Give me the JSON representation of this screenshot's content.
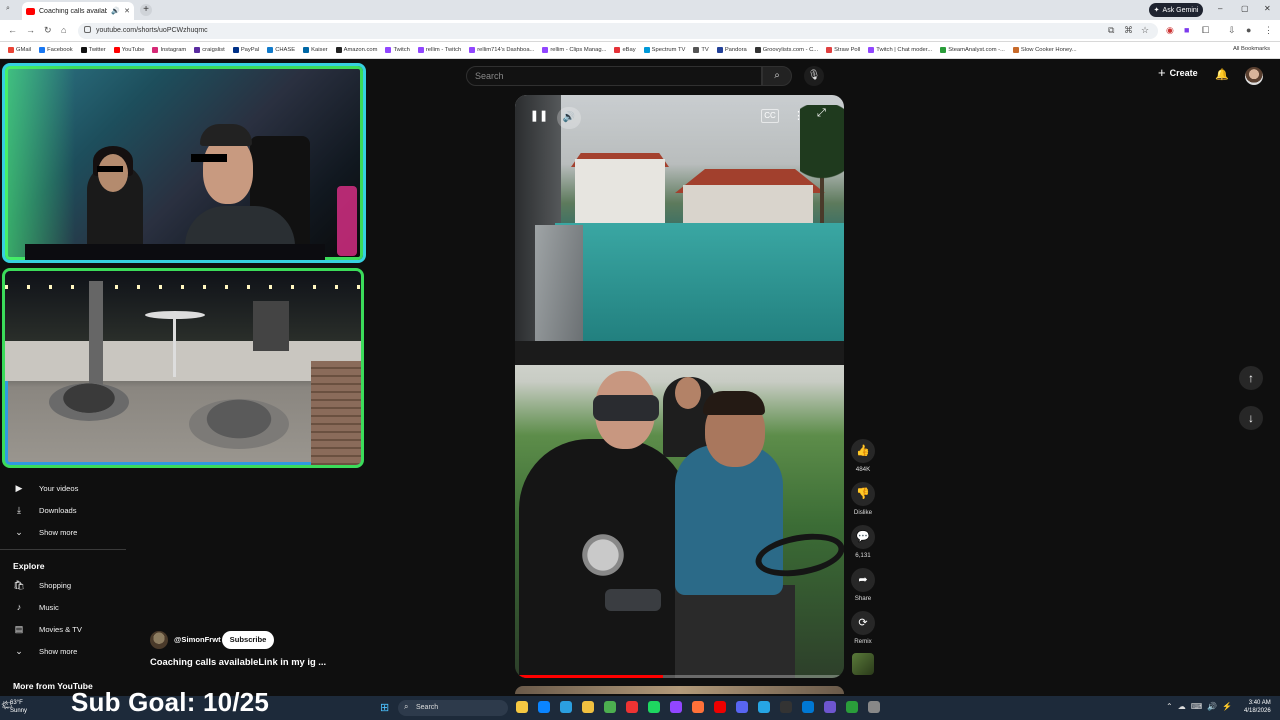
{
  "browser": {
    "tab_title": "Coaching calls availableLink",
    "new_tab": "+",
    "ask_gemini": "Ask Gemini",
    "url": "youtube.com/shorts/uoPCWzhuqmc",
    "window_controls": [
      "–",
      "▢",
      "✕"
    ],
    "bookmarks": [
      {
        "label": "GMail",
        "color": "#ea4335"
      },
      {
        "label": "Facebook",
        "color": "#1877f2"
      },
      {
        "label": "Twitter",
        "color": "#111111"
      },
      {
        "label": "YouTube",
        "color": "#ff0000"
      },
      {
        "label": "Instagram",
        "color": "#d62976"
      },
      {
        "label": "craigslist",
        "color": "#5a2ca0"
      },
      {
        "label": "PayPal",
        "color": "#003087"
      },
      {
        "label": "CHASE",
        "color": "#117aca"
      },
      {
        "label": "Kaiser",
        "color": "#0067a5"
      },
      {
        "label": "Amazon.com",
        "color": "#222222"
      },
      {
        "label": "Twitch",
        "color": "#9146ff"
      },
      {
        "label": "rellim - Twitch",
        "color": "#9146ff"
      },
      {
        "label": "rellim714's Dashboa...",
        "color": "#9146ff"
      },
      {
        "label": "rellim - Clips Manag...",
        "color": "#9146ff"
      },
      {
        "label": "eBay",
        "color": "#e53238"
      },
      {
        "label": "Spectrum TV",
        "color": "#0099d8"
      },
      {
        "label": "TV",
        "color": "#555555"
      },
      {
        "label": "Pandora",
        "color": "#224099"
      },
      {
        "label": "Groovylists.com - C...",
        "color": "#333333"
      },
      {
        "label": "Straw Poll",
        "color": "#e04040"
      },
      {
        "label": "Twitch | Chat moder...",
        "color": "#9146ff"
      },
      {
        "label": "SteamAnalyst.com -...",
        "color": "#2a9d3a"
      },
      {
        "label": "Slow Cooker Honey...",
        "color": "#c86a2a"
      }
    ],
    "all_bookmarks": "All Bookmarks"
  },
  "youtube": {
    "search_placeholder": "Search",
    "create_label": "Create",
    "sidebar": {
      "your_videos": "Your videos",
      "downloads": "Downloads",
      "show_more_1": "Show more",
      "explore_heading": "Explore",
      "shopping": "Shopping",
      "music": "Music",
      "movies_tv": "Movies & TV",
      "show_more_2": "Show more",
      "more_from_youtube": "More from YouTube"
    },
    "short": {
      "channel": "@SimonFrwt",
      "subscribe": "Subscribe",
      "title": "Coaching calls availableLink in my ig ...",
      "progress_fraction": 0.45,
      "actions": {
        "likes": "484K",
        "dislike": "Dislike",
        "comments": "6,131",
        "share": "Share",
        "remix": "Remix"
      }
    }
  },
  "overlay": {
    "sub_goal": "Sub Goal: 10/25"
  },
  "taskbar": {
    "weather_temp": "63°F",
    "weather_desc": "Sunny",
    "search_label": "Search",
    "time": "3:40 AM",
    "date": "4/18/2026",
    "icon_colors": [
      "#f5c842",
      "#0a84ff",
      "#2b9fe0",
      "#f0c040",
      "#4caf50",
      "#e33",
      "#1ed760",
      "#9146ff",
      "#ff7139",
      "#e00",
      "#5865f2",
      "#26a5e4",
      "#333",
      "#0078d4",
      "#6e56cf",
      "#2a9d3a",
      "#888"
    ]
  }
}
